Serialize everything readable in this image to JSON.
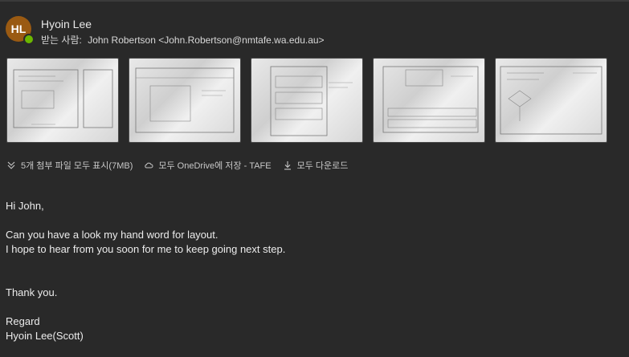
{
  "sender": {
    "initials": "HL",
    "name": "Hyoin Lee",
    "avatar_color": "#9a5a12",
    "presence_color": "#6bb700"
  },
  "recipient": {
    "label": "받는 사람:",
    "value": "John Robertson <John.Robertson@nmtafe.wa.edu.au>"
  },
  "attachments": {
    "count": 5,
    "items": [
      "sketch-1",
      "sketch-2",
      "sketch-3",
      "sketch-4",
      "sketch-5"
    ]
  },
  "actions": {
    "show_all": "5개 첨부 파일 모두 표시(7MB)",
    "save_onedrive": "모두 OneDrive에 저장 - TAFE",
    "download_all": "모두 다운로드"
  },
  "message": {
    "greeting": "Hi John,",
    "line1": "Can you have a look my hand word for layout.",
    "line2": "I hope to hear from you soon for me to keep going next step.",
    "thanks": "Thank you.",
    "closing": "Regard",
    "signature": "Hyoin Lee(Scott)"
  }
}
